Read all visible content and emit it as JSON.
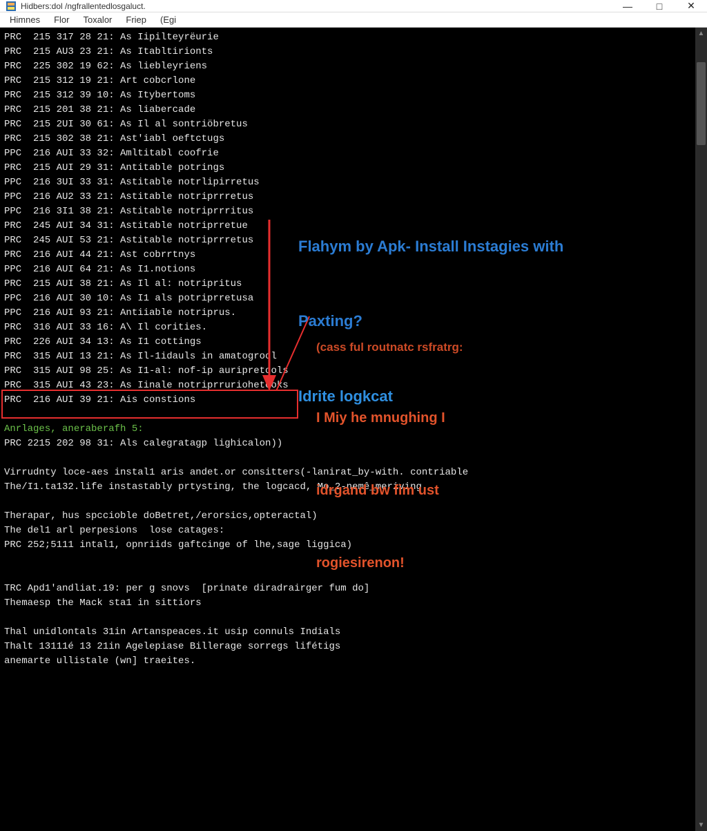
{
  "window": {
    "title": "Hidbers:dol /ngfrallentedlosgaluct."
  },
  "menubar": {
    "items": [
      "Himnes",
      "Flor",
      "Toxalor",
      "Friep",
      "(Egi"
    ]
  },
  "terminal": {
    "lines": [
      "PRC  215 317 28 21: As Iipilteyrëurie",
      "PRC  215 AU3 23 21: As Itabltirionts",
      "PRC  225 302 19 62: As liebleyriens",
      "PRC  215 312 19 21: Art cobcrlone",
      "PRC  215 312 39 10: As Itybertoms",
      "PRC  215 201 38 21: As liabercade",
      "PRC  215 2UI 30 61: As Il al sontriöbretus",
      "PRC  215 302 38 21: Ast'iabl oeftctugs",
      "PPC  216 AUI 33 32: Amltitabl coofrie",
      "PRC  215 AUI 29 31: Antitable potrings",
      "PPC  216 3UI 33 31: Astitable notrlipirretus",
      "PPC  216 AU2 33 21: Astitable notriprrretus",
      "PPC  216 3I1 38 21: Astitable notriprrritus",
      "PRC  245 AUI 34 31: Astitable notriprretue",
      "PRC  245 AUI 53 21: Astitable notriprrretus",
      "PRC  216 AUI 44 21: Ast cobrrtnys",
      "PPC  216 AUI 64 21: As I1.notions",
      "PRC  215 AUI 38 21: As Il al: notripritus",
      "PPC  216 AUI 30 10: As I1 als potriprretusa",
      "PPC  216 AUI 93 21: Antiiable notriprus.",
      "PRC  316 AUI 33 16: A\\ Il corities.",
      "PRC  226 AUI 34 13: As I1 cottings",
      "PRC  315 AUI 13 21: As Il-1idauls in amatogrool",
      "PRC  315 AUI 98 25: As I1-al: nof-ip auripretools",
      "PRC  315 AUI 43 23: As Iinale notriprruriohetooks",
      "PRC  216 AUI 39 21: Ais constions",
      "",
      "Anrlages, aneraberafh 5:",
      "PRC 2215 202 98 31: Als calegratagp lighicalon))",
      "",
      "Virrudnty loce-aes instal1 aris andet.or consitters(-lanirat_by-with. contriable",
      "The/I1.ta132.life instastably prtysting, the logcacd, Mo_2-nemê_meriving",
      "",
      "Therapar, hus spccioble doBetret,/erorsics,opteractal)",
      "The del1 arl perpesions  lose catages:",
      "PRC 252;5111 intal1, opnriids gaftcinge of lhe,sage liggica)",
      "",
      "",
      "TRC Apd1'andliat.19: per g snovs  [prinate diradrairger fum do]",
      "Themaesp the Mack sta1 in sittiors",
      "",
      "Thal unidlontals 31in Artanspeaces.it usip connuls Indials",
      "Thalt 13111é 13 21in Agelepiase Billerage sorregs lifétigs",
      "anemarte ullistale (wn] traeites."
    ],
    "green_line_index": 27
  },
  "annotations": {
    "blue": {
      "line1": "Flahym by Apk- Install Instagies with",
      "line2": "Paxting?",
      "line3": "Idrite logkcat"
    },
    "red": {
      "small": "(cass ful routnatc rsfratrg:",
      "line1": "I Miy he mnughing I",
      "line2": "idrgand bw fim ust",
      "line3": "rogiesirenon!"
    }
  },
  "controls": {
    "minimize": "—",
    "maximize": "□",
    "close": "✕"
  }
}
